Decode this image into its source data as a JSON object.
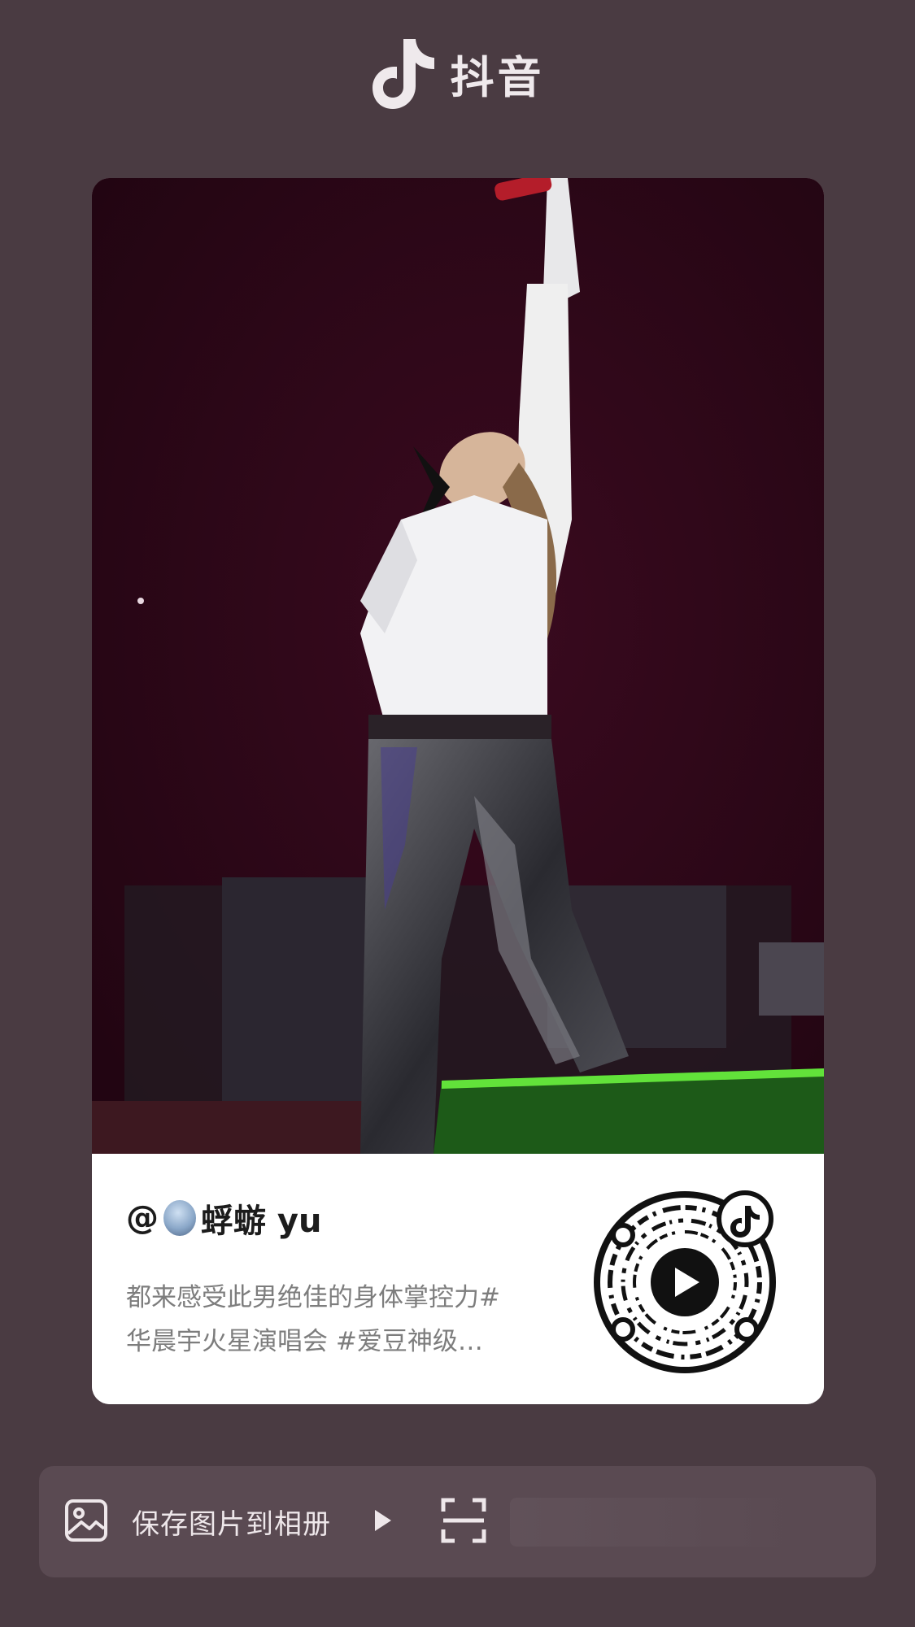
{
  "brand": {
    "icon": "douyin-logo-icon",
    "name": "抖音"
  },
  "post": {
    "at_symbol": "@",
    "author": "蜉蝣 yu",
    "caption_line1": "都来感受此男绝佳的身体掌控力#",
    "caption_line2": "华晨宇火星演唱会 #爱豆神级…"
  },
  "action_bar": {
    "save_label": "保存图片到相册",
    "save_icon": "image-icon",
    "play_icon": "play-triangle-icon",
    "scan_icon": "scan-icon"
  },
  "colors": {
    "background": "#4a3b42",
    "stage": "#2b0716",
    "caption_text": "#7d7d7d",
    "bar": "#5a4a52"
  }
}
